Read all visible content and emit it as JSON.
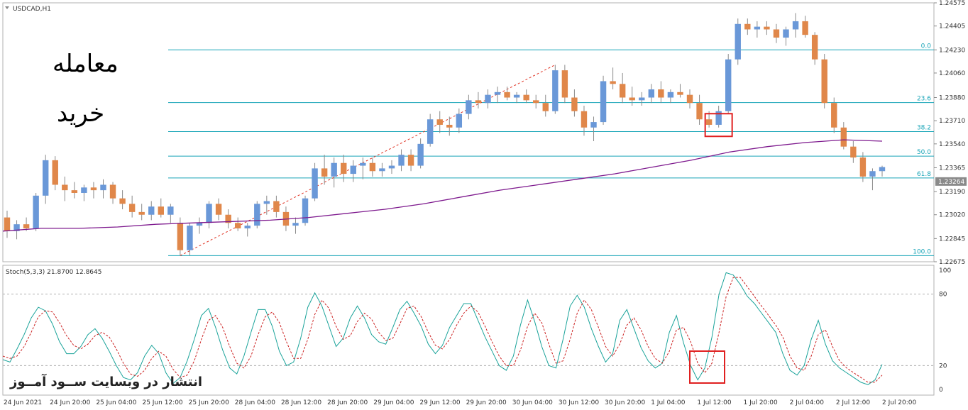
{
  "chart_data": [
    {
      "type": "candlestick",
      "title": "USDCAD,H1",
      "y_ticks": [
        "1.24575",
        "1.24405",
        "1.24230",
        "1.24060",
        "1.23880",
        "1.23710",
        "1.23540",
        "1.23365",
        "1.23190",
        "1.23020",
        "1.22845",
        "1.22675"
      ],
      "current_price": "1.23264",
      "x_ticks": [
        "24 Jun 2021",
        "24 Jun 20:00",
        "25 Jun 04:00",
        "25 Jun 12:00",
        "25 Jun 20:00",
        "28 Jun 04:00",
        "28 Jun 12:00",
        "28 Jun 20:00",
        "29 Jun 04:00",
        "29 Jun 12:00",
        "29 Jun 20:00",
        "30 Jun 04:00",
        "30 Jun 12:00",
        "30 Jun 20:00",
        "1 Jul 04:00",
        "1 Jul 12:00",
        "1 Jul 20:00",
        "2 Jul 04:00",
        "2 Jul 12:00",
        "2 Jul 20:00"
      ],
      "ylim": [
        1.22675,
        1.24575
      ],
      "candles": [
        [
          1.23,
          1.2305,
          1.2285,
          1.229
        ],
        [
          1.229,
          1.2298,
          1.2284,
          1.2295
        ],
        [
          1.2295,
          1.23,
          1.229,
          1.2292
        ],
        [
          1.2292,
          1.2318,
          1.229,
          1.2316
        ],
        [
          1.2316,
          1.2346,
          1.231,
          1.2342
        ],
        [
          1.2342,
          1.2345,
          1.232,
          1.2324
        ],
        [
          1.2324,
          1.233,
          1.2312,
          1.232
        ],
        [
          1.232,
          1.2326,
          1.2314,
          1.2318
        ],
        [
          1.2318,
          1.2324,
          1.2312,
          1.2322
        ],
        [
          1.2322,
          1.2326,
          1.2314,
          1.232
        ],
        [
          1.232,
          1.2328,
          1.2314,
          1.2324
        ],
        [
          1.2324,
          1.2326,
          1.231,
          1.2314
        ],
        [
          1.2314,
          1.232,
          1.2306,
          1.231
        ],
        [
          1.231,
          1.2316,
          1.23,
          1.2304
        ],
        [
          1.2304,
          1.231,
          1.2298,
          1.2302
        ],
        [
          1.2302,
          1.2312,
          1.2298,
          1.2308
        ],
        [
          1.2308,
          1.2314,
          1.23,
          1.2302
        ],
        [
          1.2302,
          1.231,
          1.2296,
          1.2308
        ],
        [
          1.2296,
          1.23,
          1.2272,
          1.2276
        ],
        [
          1.2276,
          1.2296,
          1.2272,
          1.2294
        ],
        [
          1.2294,
          1.23,
          1.2288,
          1.2296
        ],
        [
          1.2296,
          1.2312,
          1.2292,
          1.231
        ],
        [
          1.231,
          1.2314,
          1.2298,
          1.2302
        ],
        [
          1.2302,
          1.2306,
          1.2292,
          1.2296
        ],
        [
          1.2296,
          1.23,
          1.229,
          1.2292
        ],
        [
          1.2292,
          1.2296,
          1.2286,
          1.2294
        ],
        [
          1.2294,
          1.2312,
          1.2292,
          1.231
        ],
        [
          1.231,
          1.2316,
          1.2302,
          1.2312
        ],
        [
          1.2312,
          1.2316,
          1.23,
          1.2304
        ],
        [
          1.2304,
          1.2308,
          1.229,
          1.2294
        ],
        [
          1.2294,
          1.23,
          1.2288,
          1.2296
        ],
        [
          1.2296,
          1.2316,
          1.2294,
          1.2314
        ],
        [
          1.2314,
          1.234,
          1.2312,
          1.2336
        ],
        [
          1.2336,
          1.2346,
          1.2324,
          1.233
        ],
        [
          1.233,
          1.2344,
          1.2322,
          1.234
        ],
        [
          1.234,
          1.2346,
          1.2326,
          1.2332
        ],
        [
          1.2332,
          1.2342,
          1.2326,
          1.2338
        ],
        [
          1.2338,
          1.2344,
          1.2328,
          1.234
        ],
        [
          1.234,
          1.2344,
          1.233,
          1.2334
        ],
        [
          1.2334,
          1.234,
          1.233,
          1.2336
        ],
        [
          1.2336,
          1.2342,
          1.2332,
          1.2338
        ],
        [
          1.2338,
          1.235,
          1.2334,
          1.2346
        ],
        [
          1.2346,
          1.235,
          1.2334,
          1.2338
        ],
        [
          1.2338,
          1.2358,
          1.2336,
          1.2354
        ],
        [
          1.2354,
          1.2376,
          1.2352,
          1.2372
        ],
        [
          1.2372,
          1.2378,
          1.2362,
          1.2368
        ],
        [
          1.2368,
          1.2374,
          1.236,
          1.2366
        ],
        [
          1.2366,
          1.238,
          1.2362,
          1.2376
        ],
        [
          1.2376,
          1.239,
          1.2372,
          1.2386
        ],
        [
          1.2386,
          1.2392,
          1.238,
          1.2384
        ],
        [
          1.2384,
          1.2394,
          1.238,
          1.239
        ],
        [
          1.239,
          1.2396,
          1.2384,
          1.2392
        ],
        [
          1.2392,
          1.2396,
          1.2386,
          1.2388
        ],
        [
          1.2388,
          1.2392,
          1.2384,
          1.239
        ],
        [
          1.239,
          1.2394,
          1.2384,
          1.2386
        ],
        [
          1.2386,
          1.239,
          1.238,
          1.2384
        ],
        [
          1.2384,
          1.239,
          1.2374,
          1.2378
        ],
        [
          1.2378,
          1.2412,
          1.2376,
          1.2408
        ],
        [
          1.2408,
          1.2412,
          1.2384,
          1.2388
        ],
        [
          1.2388,
          1.2394,
          1.2374,
          1.2378
        ],
        [
          1.2378,
          1.2382,
          1.236,
          1.2366
        ],
        [
          1.2366,
          1.2374,
          1.2356,
          1.237
        ],
        [
          1.237,
          1.2404,
          1.2368,
          1.24
        ],
        [
          1.24,
          1.241,
          1.2394,
          1.2398
        ],
        [
          1.2398,
          1.2406,
          1.2384,
          1.2388
        ],
        [
          1.2388,
          1.2396,
          1.2382,
          1.2386
        ],
        [
          1.2386,
          1.2392,
          1.2382,
          1.2388
        ],
        [
          1.2388,
          1.2398,
          1.2384,
          1.2394
        ],
        [
          1.2394,
          1.24,
          1.2384,
          1.2388
        ],
        [
          1.2388,
          1.2394,
          1.2384,
          1.2392
        ],
        [
          1.2392,
          1.2398,
          1.2388,
          1.239
        ],
        [
          1.239,
          1.2394,
          1.238,
          1.2384
        ],
        [
          1.2384,
          1.239,
          1.2368,
          1.2372
        ],
        [
          1.2372,
          1.2378,
          1.2366,
          1.2368
        ],
        [
          1.2368,
          1.2382,
          1.2366,
          1.2378
        ],
        [
          1.2378,
          1.242,
          1.2376,
          1.2416
        ],
        [
          1.2416,
          1.2446,
          1.2412,
          1.2442
        ],
        [
          1.2442,
          1.2446,
          1.2434,
          1.2438
        ],
        [
          1.2438,
          1.2444,
          1.2432,
          1.244
        ],
        [
          1.244,
          1.2444,
          1.2434,
          1.2438
        ],
        [
          1.2438,
          1.2442,
          1.2428,
          1.2432
        ],
        [
          1.2432,
          1.244,
          1.2426,
          1.2438
        ],
        [
          1.2438,
          1.245,
          1.2432,
          1.2444
        ],
        [
          1.2444,
          1.2448,
          1.2432,
          1.2434
        ],
        [
          1.2434,
          1.2436,
          1.2412,
          1.2416
        ],
        [
          1.2416,
          1.242,
          1.238,
          1.2384
        ],
        [
          1.2384,
          1.2388,
          1.2362,
          1.2366
        ],
        [
          1.2366,
          1.237,
          1.235,
          1.2352
        ],
        [
          1.2352,
          1.2356,
          1.234,
          1.2344
        ],
        [
          1.2344,
          1.2348,
          1.2326,
          1.233
        ],
        [
          1.233,
          1.2336,
          1.232,
          1.2334
        ],
        [
          1.2334,
          1.2338,
          1.233,
          1.2337
        ]
      ],
      "moving_average": [
        1.229,
        1.2292,
        1.2292,
        1.2293,
        1.2295,
        1.2296,
        1.2297,
        1.2298,
        1.23,
        1.2303,
        1.2306,
        1.231,
        1.2315,
        1.232,
        1.2324,
        1.2328,
        1.2332,
        1.2337,
        1.2342,
        1.2348,
        1.2352,
        1.2355,
        1.2357,
        1.2356
      ],
      "fib_levels": [
        {
          "label": "0.0",
          "value": 1.2423
        },
        {
          "label": "23.6",
          "value": 1.23843
        },
        {
          "label": "38.2",
          "value": 1.2363
        },
        {
          "label": "50.0",
          "value": 1.2345
        },
        {
          "label": "61.8",
          "value": 1.2329
        },
        {
          "label": "100.0",
          "value": 1.2272
        }
      ],
      "colors": {
        "bull": "#6a98d8",
        "bear": "#e0874a",
        "fib": "#19a5b8",
        "ma": "#7e1a8e",
        "trend": "#e03020",
        "grid": "#c8c8c8",
        "highlight": "#e02020"
      }
    },
    {
      "type": "line",
      "title": "Stoch(5,3,3) 21.8700 12.8645",
      "ylim": [
        0,
        100
      ],
      "y_ticks": [
        "100",
        "80",
        "20",
        "0"
      ],
      "levels": [
        80,
        20
      ],
      "series": [
        {
          "name": "main",
          "values": [
            25,
            23,
            34,
            46,
            60,
            69,
            66,
            55,
            40,
            30,
            30,
            36,
            46,
            51,
            43,
            32,
            20,
            10,
            8,
            14,
            28,
            37,
            30,
            14,
            5,
            10,
            24,
            42,
            62,
            68,
            52,
            33,
            18,
            13,
            28,
            48,
            67,
            67,
            53,
            32,
            20,
            23,
            43,
            69,
            81,
            70,
            53,
            36,
            43,
            60,
            70,
            60,
            46,
            40,
            38,
            52,
            67,
            74,
            64,
            53,
            38,
            30,
            37,
            52,
            62,
            72,
            72,
            58,
            44,
            32,
            20,
            16,
            28,
            54,
            75,
            57,
            36,
            20,
            18,
            42,
            70,
            79,
            69,
            51,
            36,
            23,
            30,
            58,
            67,
            51,
            35,
            24,
            18,
            22,
            48,
            62,
            39,
            20,
            8,
            18,
            44,
            80,
            98,
            96,
            88,
            78,
            72,
            64,
            56,
            48,
            30,
            16,
            12,
            20,
            42,
            58,
            38,
            24,
            18,
            14,
            10,
            6,
            4,
            8,
            21
          ]
        },
        {
          "name": "signal",
          "values": [
            28,
            26,
            28,
            36,
            48,
            61,
            66,
            65,
            56,
            45,
            37,
            34,
            38,
            45,
            48,
            44,
            34,
            22,
            13,
            11,
            16,
            26,
            32,
            28,
            17,
            10,
            12,
            24,
            42,
            58,
            62,
            52,
            36,
            22,
            18,
            28,
            46,
            61,
            65,
            56,
            40,
            26,
            26,
            42,
            63,
            75,
            68,
            53,
            42,
            45,
            57,
            64,
            59,
            48,
            41,
            43,
            55,
            68,
            70,
            61,
            48,
            37,
            34,
            42,
            54,
            64,
            70,
            65,
            53,
            40,
            28,
            20,
            20,
            33,
            53,
            64,
            56,
            38,
            22,
            24,
            42,
            64,
            75,
            67,
            52,
            36,
            28,
            38,
            54,
            60,
            50,
            36,
            26,
            22,
            32,
            50,
            52,
            40,
            22,
            14,
            22,
            48,
            78,
            94,
            94,
            86,
            78,
            70,
            62,
            54,
            44,
            28,
            18,
            16,
            28,
            46,
            50,
            36,
            24,
            18,
            14,
            10,
            6,
            6,
            12
          ]
        }
      ],
      "colors": {
        "main": "#1aa39a",
        "signal": "#cc2222",
        "level": "#b0b0b0",
        "highlight": "#e02020"
      }
    }
  ],
  "captions": {
    "trade": "معامله",
    "buy": "خرید",
    "watermark": "انتشار در وبسایت ســود آمــوز"
  }
}
